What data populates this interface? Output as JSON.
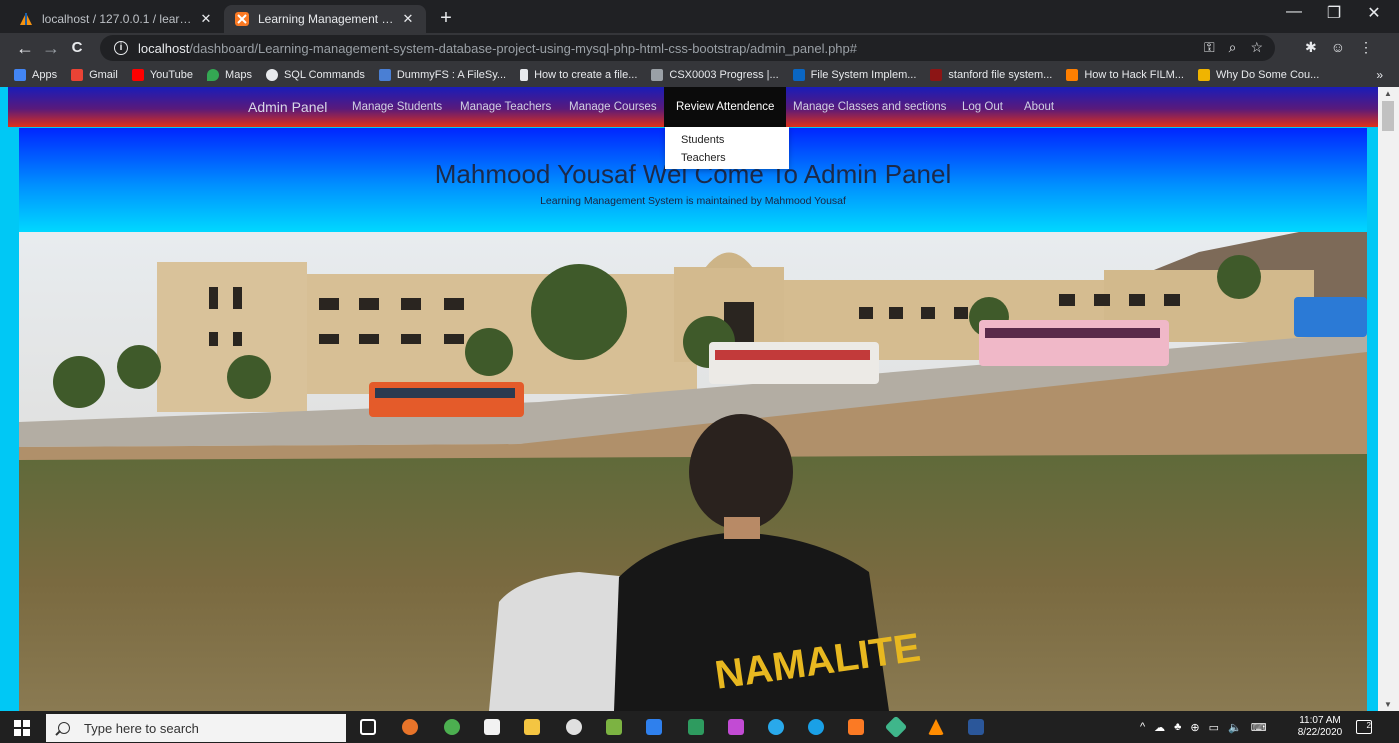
{
  "browser": {
    "tabs": [
      {
        "title": "localhost / 127.0.0.1 / learning m",
        "favicon": "phpmyadmin-sail-icon",
        "active": false
      },
      {
        "title": "Learning Management System",
        "favicon": "xampp-icon",
        "active": true
      }
    ],
    "close_glyph": "✕",
    "newtab_glyph": "+",
    "window_controls": {
      "minimize": "—",
      "restore": "❐",
      "close": "✕"
    },
    "nav": {
      "back": "←",
      "forward": "→",
      "reload": "C",
      "info": "i"
    },
    "url": {
      "host": "localhost",
      "path": "/dashboard/Learning-management-system-database-project-using-mysql-php-html-css-bootstrap/admin_panel.php#"
    },
    "omnibox_icons": {
      "key": "⚿",
      "zoom": "⌕",
      "star": "☆"
    },
    "extensions": {
      "puzzle": "✱",
      "profile": "☺",
      "menu": "⋮"
    },
    "bookmarks": [
      {
        "label": "Apps",
        "color": "#4285f4"
      },
      {
        "label": "Gmail",
        "color": "#ea4335"
      },
      {
        "label": "YouTube",
        "color": "#ff0000"
      },
      {
        "label": "Maps",
        "color": "#34a853"
      },
      {
        "label": "SQL Commands",
        "color": "#e8eaed"
      },
      {
        "label": "DummyFS : A FileSy...",
        "color": "#4a7fd4"
      },
      {
        "label": "How to create a file...",
        "color": "#e8eaed"
      },
      {
        "label": "CSX0003 Progress |...",
        "color": "#9aa0a6"
      },
      {
        "label": "File System Implem...",
        "color": "#0a66c2"
      },
      {
        "label": "stanford file system...",
        "color": "#8c1515"
      },
      {
        "label": "How to Hack FILM...",
        "color": "#ff7f00"
      },
      {
        "label": "Why Do Some Cou...",
        "color": "#f0b400"
      }
    ],
    "bookmarks_more": "»"
  },
  "page": {
    "navbar": {
      "brand": "Admin Panel",
      "links": [
        "Manage Students",
        "Manage Teachers",
        "Manage Courses",
        "Review Attendence",
        "Manage Classes and sections",
        "Log Out",
        "About"
      ],
      "active_link": "Review Attendence"
    },
    "dropdown": [
      "Students",
      "Teachers"
    ],
    "header": {
      "title": "Mahmood Yousaf Wel Come To Admin Panel",
      "subtitle": "Learning Management System is maintained by Mahmood Yousaf"
    },
    "photo": {
      "jacket_text": "NAMALITE"
    }
  },
  "scrollbar": {
    "up": "▲",
    "down": "▼"
  },
  "taskbar": {
    "search_placeholder": "Type here to search",
    "tray": [
      "^",
      "☁",
      "♣",
      "⊕",
      "▭",
      "🔈",
      "⌨"
    ],
    "time": "11:07 AM",
    "date": "8/22/2020",
    "notification_count": "2"
  },
  "colors": {
    "navbar_top": "#1a1cb8",
    "navbar_bottom": "#e0301a",
    "page_background": "#00c8f5",
    "header_top": "#0026ff",
    "header_bottom": "#00d8ff",
    "jacket_text": "#e8b820"
  }
}
